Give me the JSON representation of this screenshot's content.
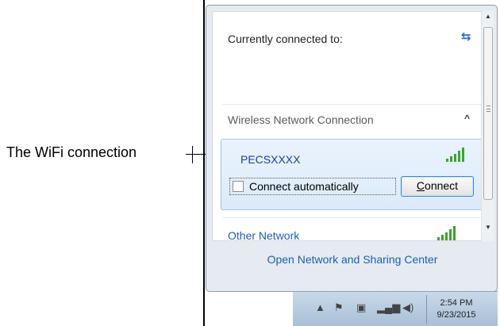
{
  "annotation": {
    "label": "The WiFi connection"
  },
  "flyout": {
    "connected_title": "Currently connected to:",
    "section_title": "Wireless Network Connection",
    "network": {
      "name": "PECSXXXX",
      "auto_connect_label": "Connect automatically",
      "auto_connect_checked": false,
      "connect_button": "Connect",
      "signal_bars": 5
    },
    "other_network": "Other Network",
    "footer_link": "Open Network and Sharing Center"
  },
  "taskbar": {
    "time": "2:54 PM",
    "date": "9/23/2015",
    "icons": [
      "show-hidden-icons",
      "action-center-flag-icon",
      "network-icon",
      "signal-strength-icon",
      "volume-icon"
    ]
  },
  "colors": {
    "link": "#1a5fb4",
    "network_name": "#1a3da5",
    "signal": "#3aa52c",
    "selected_row": "#dbeafa"
  }
}
